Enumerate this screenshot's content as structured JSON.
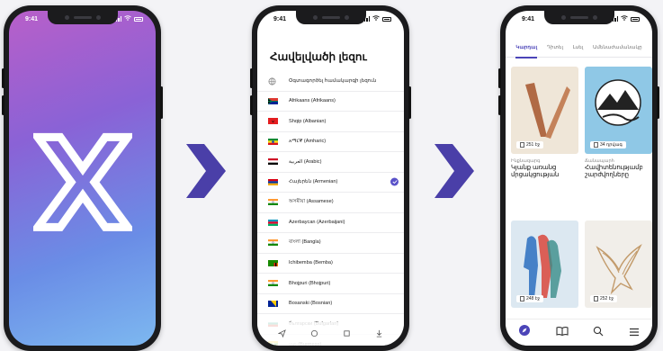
{
  "status_time": "9:41",
  "colors": {
    "accent": "#4b44b8",
    "arrow": "#4a3fa8"
  },
  "language_screen": {
    "title": "Հավելվածի լեզու",
    "languages": [
      {
        "label": "Օգտագործել համակարգի լեզուն",
        "flag": "globe-icon"
      },
      {
        "label": "Afrikaans (Afrikaans)",
        "flag": "flag-south-africa-icon"
      },
      {
        "label": "Shqip (Albanian)",
        "flag": "flag-albania-icon"
      },
      {
        "label": "አማርኛ (Amharic)",
        "flag": "flag-ethiopia-icon"
      },
      {
        "label": "العربية (Arabic)",
        "flag": "flag-egypt-icon"
      },
      {
        "label": "Հայերեն (Armenian)",
        "flag": "flag-armenia-icon",
        "selected": true
      },
      {
        "label": "অসমীয়া (Assamese)",
        "flag": "flag-india-icon"
      },
      {
        "label": "Azerbaycan (Azerbaijani)",
        "flag": "flag-azerbaijan-icon"
      },
      {
        "label": "বাংলা (Bangla)",
        "flag": "flag-india-icon"
      },
      {
        "label": "Ichibemba (Bemba)",
        "flag": "flag-zambia-icon"
      },
      {
        "label": "Bhojpuri (Bhojpuri)",
        "flag": "flag-india-icon"
      },
      {
        "label": "Bosanski (Bosnian)",
        "flag": "flag-bosnia-icon"
      },
      {
        "label": "български (Bulgarian)",
        "flag": "flag-bulgaria-icon"
      },
      {
        "label": "ဗမာ (Burmese)",
        "flag": "flag-myanmar-icon"
      }
    ]
  },
  "library_screen": {
    "tabs": [
      "Կարդալ",
      "Դիտել",
      "Լսել",
      "Ամենաժամանակը"
    ],
    "books": [
      {
        "pages": "251 էջ",
        "category": "Ինքնազարգ",
        "title": "Կյանք առանց մրցակցության"
      },
      {
        "pages": "34 դրվագ",
        "category": "Ճանապարհ",
        "title": "Հավիտենությամբ շարժվողները"
      },
      {
        "pages": "248 էջ",
        "category": "",
        "title": ""
      },
      {
        "pages": "252 էջ",
        "category": "",
        "title": ""
      }
    ]
  }
}
